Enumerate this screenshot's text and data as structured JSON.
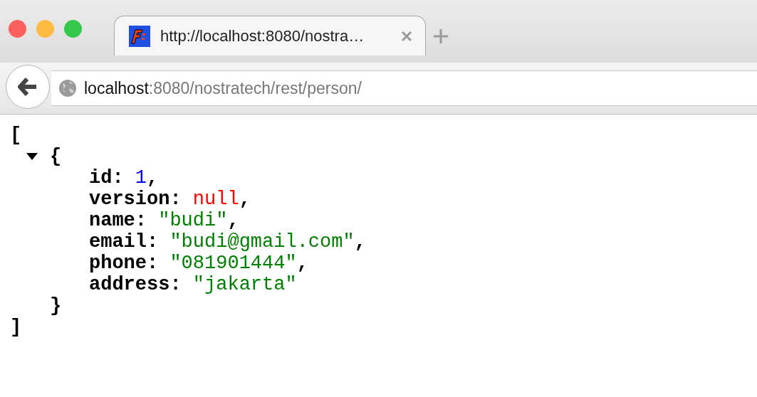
{
  "tab": {
    "title": "http://localhost:8080/nostra…",
    "selected": true
  },
  "address_bar": {
    "host": "localhost",
    "path": ":8080/nostratech/rest/person/"
  },
  "json_view": {
    "open": "[",
    "close": "]",
    "items": [
      {
        "open": "{",
        "close": "}",
        "expanded": true,
        "fields": [
          {
            "key": "id:",
            "value": "1",
            "kind": "number",
            "trail": ","
          },
          {
            "key": "version:",
            "value": "null",
            "kind": "null",
            "trail": ","
          },
          {
            "key": "name:",
            "value": "\"budi\"",
            "kind": "string",
            "trail": ","
          },
          {
            "key": "email:",
            "value": "\"budi@gmail.com\"",
            "kind": "string",
            "trail": ","
          },
          {
            "key": "phone:",
            "value": "\"081901444\"",
            "kind": "string",
            "trail": ","
          },
          {
            "key": "address:",
            "value": "\"jakarta\"",
            "kind": "string"
          }
        ]
      }
    ]
  }
}
